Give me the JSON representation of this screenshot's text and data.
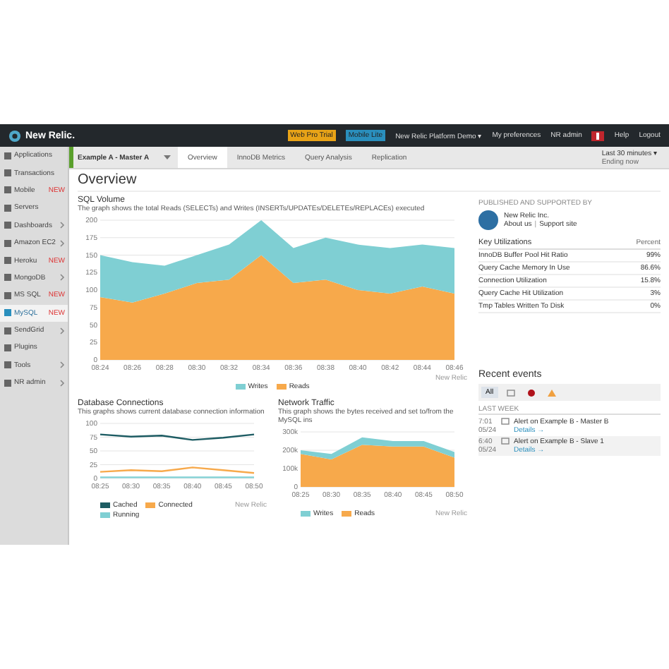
{
  "topbar": {
    "logo": "New Relic.",
    "badges": [
      {
        "label": "Web Pro Trial",
        "color": "#e8a317"
      },
      {
        "label": "Mobile Lite",
        "color": "#2a8fbd"
      }
    ],
    "menu": [
      "New Relic Platform Demo ▾",
      "My preferences",
      "NR admin"
    ],
    "links": [
      "Help",
      "Logout"
    ]
  },
  "sidebar": {
    "items": [
      {
        "label": "Applications",
        "submenu": false,
        "selected": false
      },
      {
        "label": "Transactions",
        "submenu": false,
        "selected": false
      },
      {
        "label": "Mobile",
        "badge": "NEW",
        "submenu": false,
        "selected": false
      },
      {
        "label": "Servers",
        "submenu": false,
        "selected": false
      },
      {
        "label": "Dashboards",
        "submenu": true,
        "selected": false
      },
      {
        "label": "Amazon EC2",
        "submenu": true,
        "selected": false
      },
      {
        "label": "Heroku",
        "badge": "NEW",
        "submenu": false,
        "selected": false
      },
      {
        "label": "MongoDB",
        "submenu": true,
        "selected": false
      },
      {
        "label": "MS SQL",
        "badge": "NEW",
        "submenu": false,
        "selected": false
      },
      {
        "label": "MySQL",
        "badge": "NEW",
        "submenu": false,
        "selected": true
      },
      {
        "label": "SendGrid",
        "submenu": true,
        "selected": false
      },
      {
        "label": "Plugins",
        "submenu": false,
        "selected": false
      },
      {
        "label": "Tools",
        "submenu": true,
        "selected": false
      },
      {
        "label": "NR admin",
        "submenu": true,
        "selected": false
      }
    ]
  },
  "instance": "Example A - Master A",
  "tabs": [
    {
      "label": "Overview",
      "selected": true
    },
    {
      "label": "InnoDB Metrics",
      "selected": false
    },
    {
      "label": "Query Analysis",
      "selected": false
    },
    {
      "label": "Replication",
      "selected": false
    }
  ],
  "time_range": {
    "label": "Last 30 minutes ▾",
    "sub": "Ending now"
  },
  "page_title": "Overview",
  "sql_volume": {
    "title": "SQL Volume",
    "description": "The graph shows the total Reads (SELECTs) and Writes (INSERTs/UPDATEs/DELETEs/REPLACEs) executed",
    "credit": "New Relic",
    "chart_data": {
      "type": "area",
      "stacked": true,
      "grid": true,
      "categories": [
        "08:24",
        "08:26",
        "08:28",
        "08:30",
        "08:32",
        "08:34",
        "08:36",
        "08:38",
        "08:40",
        "08:42",
        "08:44",
        "08:46"
      ],
      "ylim": [
        0,
        200
      ],
      "yticks": [
        0,
        25,
        50,
        75,
        100,
        125,
        150,
        175,
        200
      ],
      "series": [
        {
          "name": "Reads",
          "color": "#f7a94b",
          "values": [
            90,
            82,
            95,
            110,
            115,
            150,
            110,
            115,
            100,
            95,
            105,
            95
          ]
        },
        {
          "name": "Writes",
          "color": "#7fcfd3",
          "values": [
            60,
            58,
            40,
            40,
            50,
            50,
            50,
            60,
            65,
            65,
            60,
            65
          ]
        }
      ]
    }
  },
  "publisher": {
    "caption": "PUBLISHED AND SUPPORTED BY",
    "name": "New Relic Inc.",
    "links": [
      "About us",
      "Support site"
    ],
    "separator": "|"
  },
  "key_utilizations": {
    "title": "Key Utilizations",
    "column": "Percent",
    "rows": [
      {
        "name": "InnoDB Buffer Pool Hit Ratio",
        "value": "99%"
      },
      {
        "name": "Query Cache Memory In Use",
        "value": "86.6%"
      },
      {
        "name": "Connection Utilization",
        "value": "15.8%"
      },
      {
        "name": "Query Cache Hit Utilization",
        "value": "3%"
      },
      {
        "name": "Tmp Tables Written To Disk",
        "value": "0%"
      }
    ]
  },
  "db_connections": {
    "title": "Database Connections",
    "description": "This graphs shows current database connection information",
    "credit": "New Relic",
    "chart_data": {
      "type": "line",
      "grid": true,
      "categories": [
        "08:25",
        "08:30",
        "08:35",
        "08:40",
        "08:45",
        "08:50"
      ],
      "ylim": [
        0,
        100
      ],
      "yticks": [
        0,
        25,
        50,
        75,
        100
      ],
      "series": [
        {
          "name": "Running",
          "color": "#7fcfd3",
          "values": [
            2,
            2,
            2,
            2,
            2,
            2
          ]
        },
        {
          "name": "Connected",
          "color": "#f7a94b",
          "values": [
            12,
            15,
            13,
            20,
            15,
            10
          ]
        },
        {
          "name": "Cached",
          "color": "#1d5c63",
          "values": [
            80,
            76,
            78,
            70,
            74,
            80
          ]
        }
      ]
    }
  },
  "network_traffic": {
    "title": "Network Traffic",
    "description": "This graph shows the bytes received and set to/from the MySQL ins",
    "credit": "New Relic",
    "chart_data": {
      "type": "area",
      "stacked": true,
      "grid": true,
      "categories": [
        "08:25",
        "08:30",
        "08:35",
        "08:40",
        "08:45",
        "08:50"
      ],
      "ylim": [
        0,
        300
      ],
      "yticks": [
        0,
        {
          "value": 100,
          "label": "100k"
        },
        {
          "value": 200,
          "label": "200k"
        },
        {
          "value": 300,
          "label": "300k"
        }
      ],
      "series": [
        {
          "name": "Reads",
          "color": "#f7a94b",
          "values": [
            180,
            150,
            230,
            220,
            220,
            160
          ]
        },
        {
          "name": "Writes",
          "color": "#7fcfd3",
          "values": [
            20,
            30,
            40,
            30,
            30,
            30
          ]
        }
      ]
    }
  },
  "recent_events": {
    "title": "Recent events",
    "filters": [
      {
        "kind": "all",
        "label": "All",
        "selected": true
      },
      {
        "kind": "message",
        "selected": false
      },
      {
        "kind": "critical",
        "selected": false
      },
      {
        "kind": "warning",
        "selected": false
      }
    ],
    "group": "LAST WEEK",
    "events": [
      {
        "time": "7:01",
        "date": "05/24",
        "title": "Alert on Example B - Master B",
        "link": "Details →"
      },
      {
        "time": "6:40",
        "date": "05/24",
        "title": "Alert on Example B - Slave 1",
        "link": "Details →"
      }
    ]
  }
}
